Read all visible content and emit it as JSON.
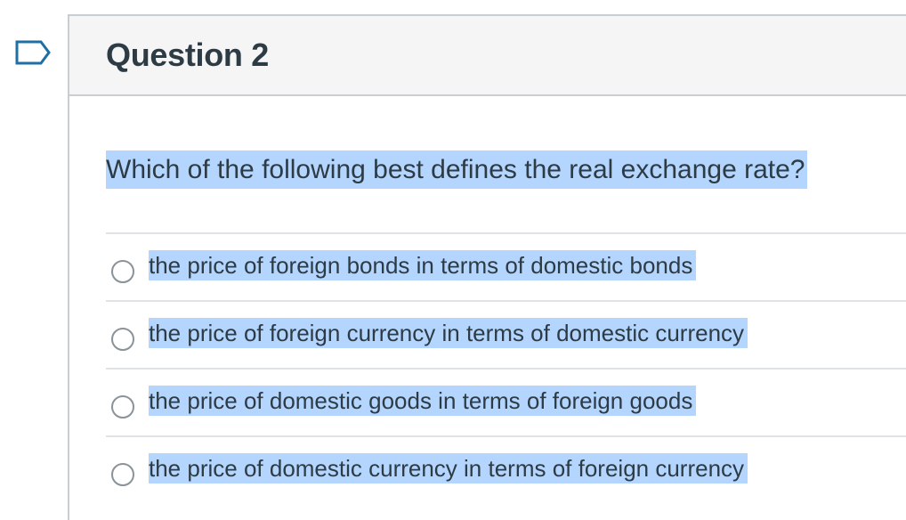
{
  "question": {
    "title": "Question 2",
    "text": "Which of the following best defines the real exchange rate?"
  },
  "answers": [
    {
      "label": "the price of foreign bonds in terms of domestic bonds"
    },
    {
      "label": "the price of foreign currency in terms of domestic currency"
    },
    {
      "label": "the price of domestic goods in terms of foreign goods"
    },
    {
      "label": "the price of domestic currency in terms of foreign currency"
    }
  ],
  "colors": {
    "selection_highlight": "#b4d5fe",
    "text": "#2d3b45",
    "border": "#c7cdd1",
    "header_bg": "#f5f5f5"
  }
}
